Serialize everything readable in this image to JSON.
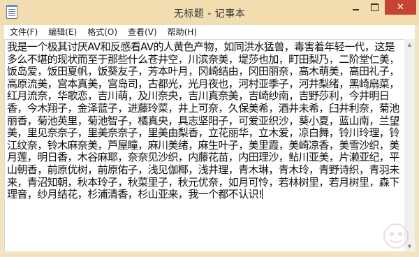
{
  "window": {
    "title": "无标题 - 记事本",
    "controls": {
      "minimize_icon": "minimize-icon",
      "maximize_icon": "maximize-icon",
      "close_glyph": "✕"
    }
  },
  "menu": {
    "items": [
      {
        "label": "文件(F)"
      },
      {
        "label": "编辑(E)"
      },
      {
        "label": "格式(O)"
      },
      {
        "label": "查看(V)"
      },
      {
        "label": "帮助(H)"
      }
    ]
  },
  "editor": {
    "content": "我是一个极其讨厌AV和反感看AV的人黄色产物，如同洪水猛兽，毒害着年轻一代，这是多么不堪的现状而至于那些什么苍井空，川滨奈美，堤莎也加，町田梨乃，二阶堂仁美，饭岛爱，饭田夏帆，饭葵友子，芳本叶月，冈崎结由，冈田丽奈，高木萌美，高田礼子，高原流美，宫本真美，宫岛司，古都光，光月夜也，河村亚季子，河井梨绪，黑崎扇菜，红月流奈，华歌恋，吉川萌，及川奈央，吉川真奈美，吉崎纱南，吉野莎利，今井明日香，今木翔子，金泽蓝子，进藤玲菜，井上可奈，久保美希，酒井未希，臼井利奈，菊池丽香，菊池英里，菊池智子，橘真央，具志坚阳子，可爱亚织沙，葵小夏，蓝山南，兰望美，里见奈奈子，里美奈奈子，里美由梨香，立花丽华，立木爱，凉白舞，铃川玲理，铃江纹奈，铃木麻奈美，芦屋瞳，麻川美绪，麻生叶子，美里霞，美崎凉香，美雪沙织，美月莲，明日香，木谷麻耶，奈奈见沙织，内藤花苗，内田理沙，鲇川亚美，片濑亚纪，平山朝香，前原优树，前原佑子，浅见伽椰，浅井理，青木琳，青木玲，青野诗织，青羽未来，青沼知朝，秋本玲子，秋菜里子，秋元优奈，如月可怜，若林树里，若月树里，森下理音，纱月结花，杉浦清香，杉山亚来，我一个都不认识!"
  },
  "watermark": {
    "icon": "logo-watermark-icon"
  },
  "colors": {
    "frame": "#f3e4bf",
    "close_button": "#c74434",
    "editor_background": "#ffffff"
  }
}
